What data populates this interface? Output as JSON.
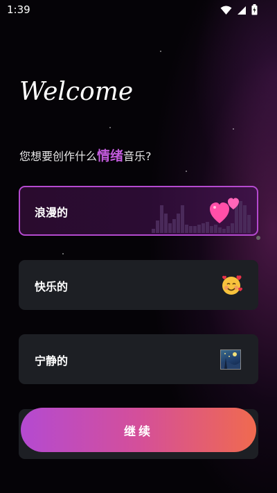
{
  "status_bar": {
    "time": "1:39",
    "icons": [
      "wifi-icon",
      "signal-icon",
      "battery-icon"
    ]
  },
  "header": {
    "welcome": "Welcome"
  },
  "prompt": {
    "before": "您想要创作什么",
    "highlight": "情绪",
    "after": "音乐?"
  },
  "moods": [
    {
      "label": "浪漫的",
      "icon": "hearts-icon",
      "selected": true
    },
    {
      "label": "快乐的",
      "icon": "smiling-face-with-hearts-icon",
      "selected": false
    },
    {
      "label": "宁静的",
      "icon": "night-scene-icon",
      "selected": false
    }
  ],
  "continue_button": {
    "label": "继续"
  },
  "colors": {
    "accent": "#c25bdc",
    "card": "#1d1f24",
    "selected_border": "#b54ad0",
    "button_start": "#b44ad1",
    "button_end": "#f06a4f"
  }
}
